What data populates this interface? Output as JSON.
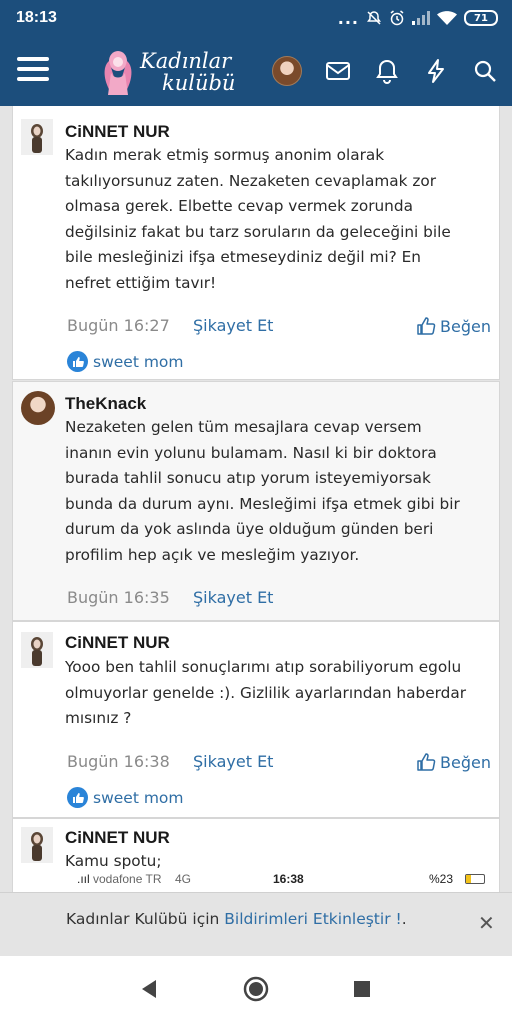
{
  "status_bar": {
    "time": "18:13",
    "dots": "...",
    "battery": "71"
  },
  "app_bar": {
    "logo_line1": "Kadınlar",
    "logo_line2": "kulübü",
    "icons": [
      "menu-icon",
      "user-avatar",
      "mail-icon",
      "bell-icon",
      "lightning-icon",
      "search-icon"
    ]
  },
  "posts": [
    {
      "author": "CiNNET NUR",
      "lines": [
        "Kadın merak etmiş sormuş anonim olarak",
        "takılıyorsunuz zaten. Nezaketen cevaplamak zor",
        "olmasa gerek. Elbette cevap vermek zorunda",
        "değilsiniz fakat bu tarz soruların da geleceğini bile",
        "bile mesleğinizi ifşa etmeseydiniz değil mi? En",
        "nefret ettiğim tavır!"
      ],
      "time": "Bugün 16:27",
      "report": "Şikayet Et",
      "like": "Beğen",
      "reaction_user": "sweet mom"
    },
    {
      "author": "TheKnack",
      "lines": [
        "Nezaketen gelen tüm mesajlara cevap versem",
        "inanın evin yolunu bulamam. Nasıl ki bir doktora",
        "burada tahlil sonucu atıp yorum isteyemiyorsak",
        "bunda da durum aynı. Mesleğimi ifşa etmek gibi bir",
        "durum da yok aslında üye olduğum günden beri",
        "profilim hep açık ve mesleğim yazıyor."
      ],
      "time": "Bugün 16:35",
      "report": "Şikayet Et"
    },
    {
      "author": "CiNNET NUR",
      "lines": [
        "Yooo ben tahlil sonuçlarımı atıp sorabiliyorum egolu",
        "olmuyorlar genelde :). Gizlilik ayarlarından haberdar",
        "mısınız ?"
      ],
      "time": "Bugün 16:38",
      "report": "Şikayet Et",
      "like": "Beğen",
      "reaction_user": "sweet mom"
    },
    {
      "author": "CiNNET NUR",
      "lines": [
        "Kamu spotu;"
      ],
      "embedded": {
        "carrier": "vodafone TR",
        "network": "4G",
        "time": "16:38",
        "battery": "%23"
      }
    }
  ],
  "banner": {
    "prefix": "Kadınlar Kulübü için ",
    "link": "Bildirimleri Etkinleştir !",
    "suffix": ".",
    "close": "✕"
  }
}
